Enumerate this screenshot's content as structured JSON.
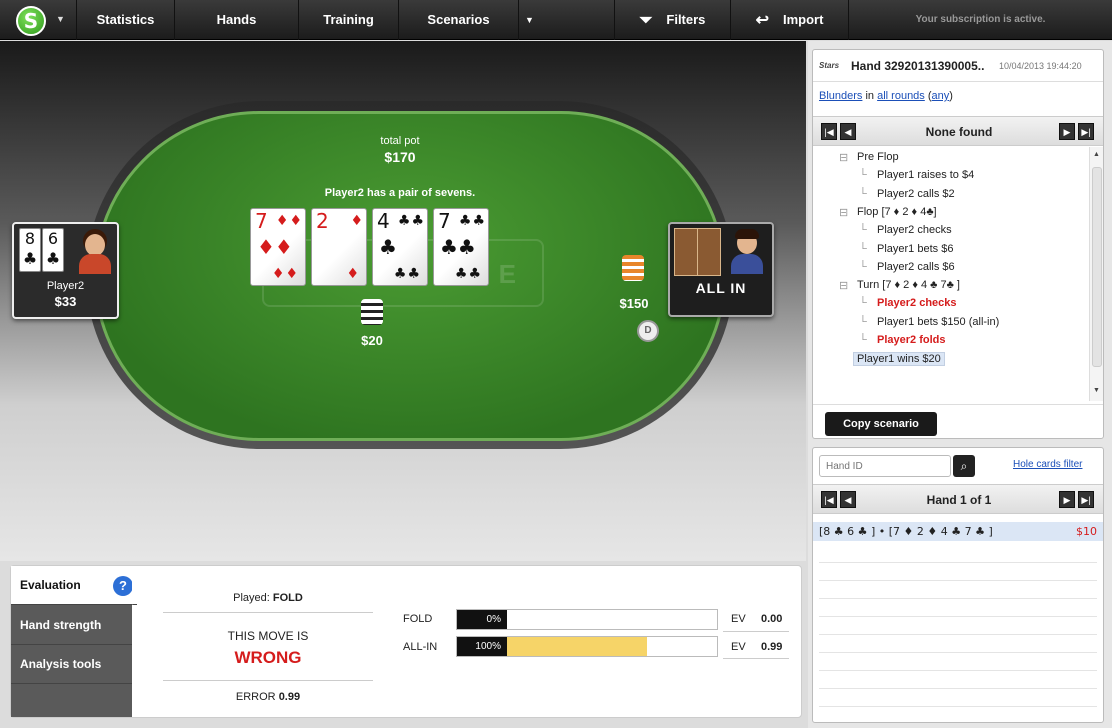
{
  "app": {
    "logo_letter": "S",
    "nav": [
      "Statistics",
      "Hands",
      "Training",
      "Scenarios"
    ],
    "filters_label": "Filters",
    "import_label": "Import",
    "subscription": "Your subscription is active."
  },
  "table": {
    "pot_label": "total pot",
    "pot_amount": "$170",
    "hand_message": "Player2 has a pair of sevens.",
    "watermark": "E",
    "board": [
      {
        "rank": "7",
        "suit": "♦",
        "color": "red"
      },
      {
        "rank": "2",
        "suit": "♦",
        "color": "red"
      },
      {
        "rank": "4",
        "suit": "♣",
        "color": "black"
      },
      {
        "rank": "7",
        "suit": "♣",
        "color": "black"
      }
    ],
    "player2": {
      "name": "Player2",
      "stack": "$33",
      "cards": [
        "8",
        "6"
      ],
      "card_suit": "♣",
      "bet": "$20"
    },
    "player1": {
      "status": "ALL IN",
      "bet": "$150"
    },
    "dealer_label": "D"
  },
  "evaluation": {
    "tabs": [
      "Evaluation",
      "Hand strength",
      "Analysis tools"
    ],
    "help": "?",
    "played_prefix": "Played:",
    "played_action": "FOLD",
    "verdict_label": "THIS MOVE IS",
    "verdict": "WRONG",
    "error_label": "ERROR",
    "error_value": "0.99",
    "actions": [
      {
        "name": "FOLD",
        "pct_label": "0%",
        "pct": 0,
        "ev_label": "EV",
        "ev": "0.00"
      },
      {
        "name": "ALL-IN",
        "pct_label": "100%",
        "pct": 100,
        "ev_label": "EV",
        "ev": "0.99"
      }
    ]
  },
  "sidebar": {
    "site_logo": "Stars",
    "hand_title": "Hand 32920131390005..",
    "hand_date": "10/04/2013  19:44:20",
    "blunders": {
      "a": "Blunders",
      "in": "in",
      "b": "all rounds",
      "c": "any"
    },
    "nav_title": "None found",
    "tree": [
      {
        "text": "Pre Flop",
        "type": "street"
      },
      {
        "text": "Player1 raises to $4",
        "type": "action"
      },
      {
        "text": "Player2 calls $2",
        "type": "action"
      },
      {
        "text": "Flop [7 ♦ 2 ♦ 4♣]",
        "type": "street"
      },
      {
        "text": "Player2 checks",
        "type": "action"
      },
      {
        "text": "Player1 bets $6",
        "type": "action"
      },
      {
        "text": "Player2 calls $6",
        "type": "action"
      },
      {
        "text": "Turn [7 ♦ 2 ♦ 4 ♣ 7♣ ]",
        "type": "street"
      },
      {
        "text": "Player2 checks",
        "type": "bad"
      },
      {
        "text": "Player1 bets $150 (all-in)",
        "type": "action"
      },
      {
        "text": "Player2 folds",
        "type": "bad"
      },
      {
        "text": "Player1 wins $20",
        "type": "win"
      }
    ],
    "copy_button": "Copy scenario",
    "hand_id_placeholder": "Hand ID",
    "hole_cards_filter": "Hole cards filter",
    "list_title": "Hand 1 of 1",
    "hand_row": {
      "text": "[8 ♣ 6 ♣ ]  •  [7 ♦ 2 ♦ 4 ♣ 7 ♣ ]",
      "amount": "$10"
    }
  }
}
